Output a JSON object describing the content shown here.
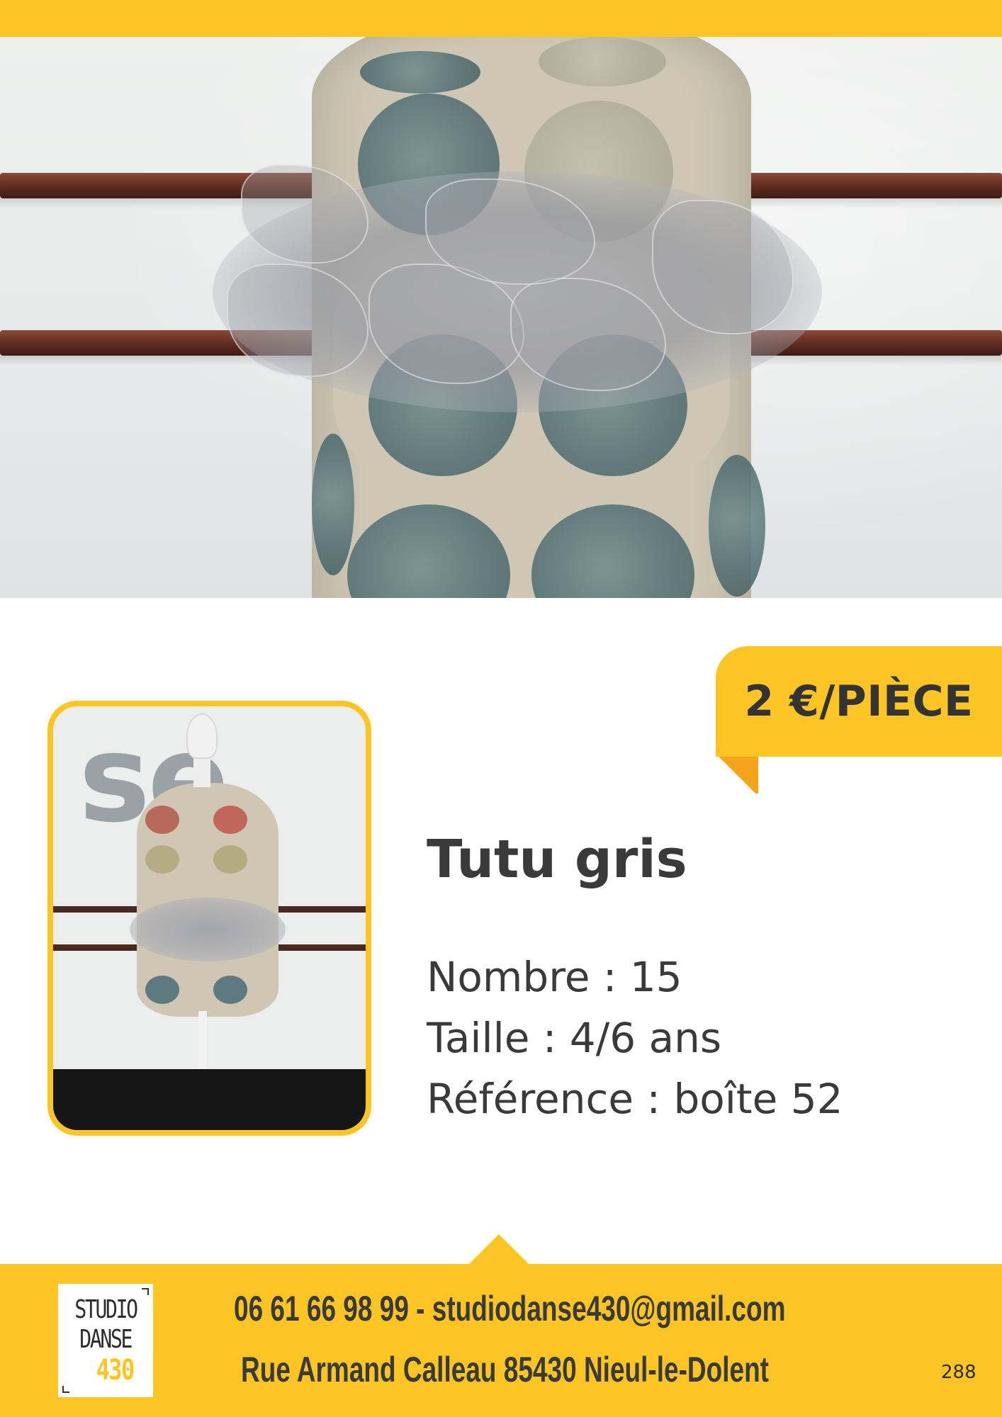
{
  "price": "2 €/PIÈCE",
  "product": {
    "title": "Tutu gris",
    "count": "Nombre : 15",
    "size": "Taille : 4/6 ans",
    "reference": "Référence : boîte 52"
  },
  "thumbnail": {
    "wall_letters": "se"
  },
  "footer": {
    "logo": {
      "line1": "STUDIO",
      "line2": "DANSE",
      "line3": "430"
    },
    "contact": "06 61 66 98 99 - studiodanse430@gmail.com",
    "address": "Rue Armand Calleau 85430 Nieul-le-Dolent",
    "page_number": "288"
  },
  "colors": {
    "accent": "#fcc524",
    "accent_dark": "#f5a01c",
    "text": "#3a3a3a"
  }
}
